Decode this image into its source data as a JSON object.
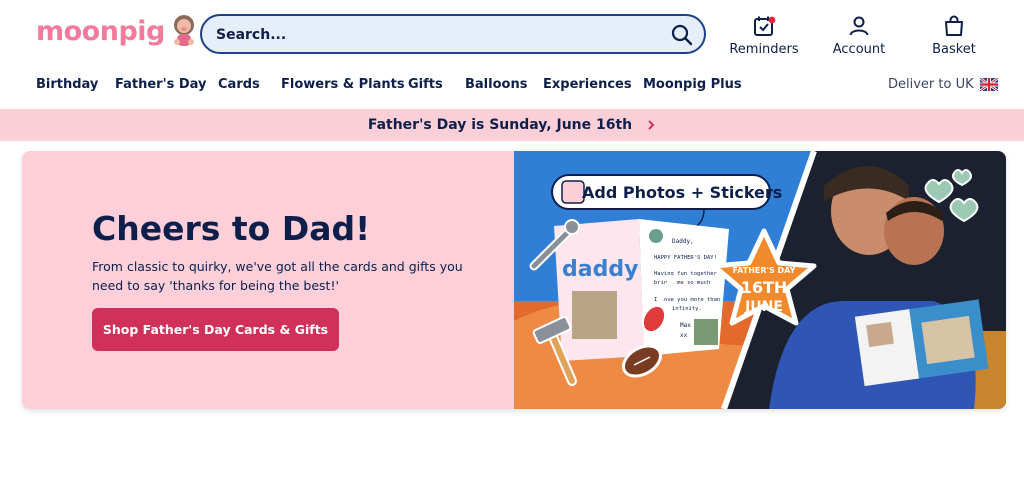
{
  "header": {
    "logo_text": "moonpig",
    "search": {
      "placeholder": "Search..."
    },
    "links": [
      {
        "label": "Reminders"
      },
      {
        "label": "Account"
      },
      {
        "label": "Basket"
      }
    ]
  },
  "nav": {
    "items": [
      {
        "label": "Birthday"
      },
      {
        "label": "Father's Day"
      },
      {
        "label": "Cards"
      },
      {
        "label": "Flowers & Plants"
      },
      {
        "label": "Gifts"
      },
      {
        "label": "Balloons"
      },
      {
        "label": "Experiences"
      },
      {
        "label": "Moonpig Plus"
      }
    ],
    "deliver_label": "Deliver to UK"
  },
  "strip": {
    "text": "Father's Day is Sunday, June 16th"
  },
  "hero": {
    "title": "Cheers to Dad!",
    "subtitle": "From classic to quirky, we've got all the cards and gifts you need to say 'thanks for being the best!'",
    "button_label": "Shop Father's Day Cards & Gifts",
    "image": {
      "badge_text": "Add Photos + Stickers",
      "card_word": "daddy",
      "card_lines": [
        "Daddy,",
        "HAPPY FATHER'S DAY!",
        "Having fun together",
        "brings me so much",
        "I love you more than",
        "infinity.",
        "Max",
        "xx"
      ],
      "star_line1": "FATHER'S DAY",
      "star_line2": "16TH",
      "star_line3": "JUNE"
    }
  },
  "colors": {
    "brand_pink": "#f27a9b",
    "navy": "#0d1f4a",
    "strip_pink": "#fbcfd8",
    "cta": "#d0305a"
  }
}
